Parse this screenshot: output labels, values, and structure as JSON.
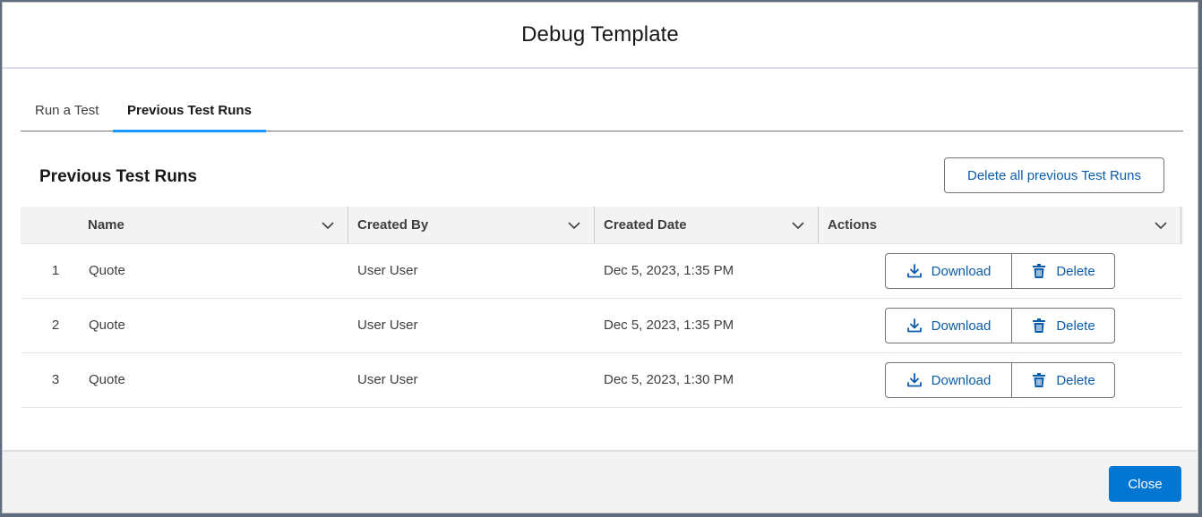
{
  "modal": {
    "title": "Debug Template"
  },
  "tabs": [
    {
      "label": "Run a Test",
      "active": false
    },
    {
      "label": "Previous Test Runs",
      "active": true
    }
  ],
  "section": {
    "title": "Previous Test Runs",
    "delete_all_label": "Delete all previous Test Runs"
  },
  "table": {
    "columns": [
      "Name",
      "Created By",
      "Created Date",
      "Actions"
    ],
    "rows": [
      {
        "num": "1",
        "name": "Quote",
        "created_by": "User User",
        "created_date": "Dec 5, 2023, 1:35 PM"
      },
      {
        "num": "2",
        "name": "Quote",
        "created_by": "User User",
        "created_date": "Dec 5, 2023, 1:35 PM"
      },
      {
        "num": "3",
        "name": "Quote",
        "created_by": "User User",
        "created_date": "Dec 5, 2023, 1:30 PM"
      }
    ],
    "actions": {
      "download_label": "Download",
      "delete_label": "Delete"
    }
  },
  "footer": {
    "close_label": "Close"
  },
  "colors": {
    "brand": "#0176d3",
    "link": "#0b5cab",
    "tab_active": "#1b96ff"
  },
  "icons": {
    "sort": "chevron-down-icon",
    "download": "download-icon",
    "delete": "trash-icon"
  }
}
